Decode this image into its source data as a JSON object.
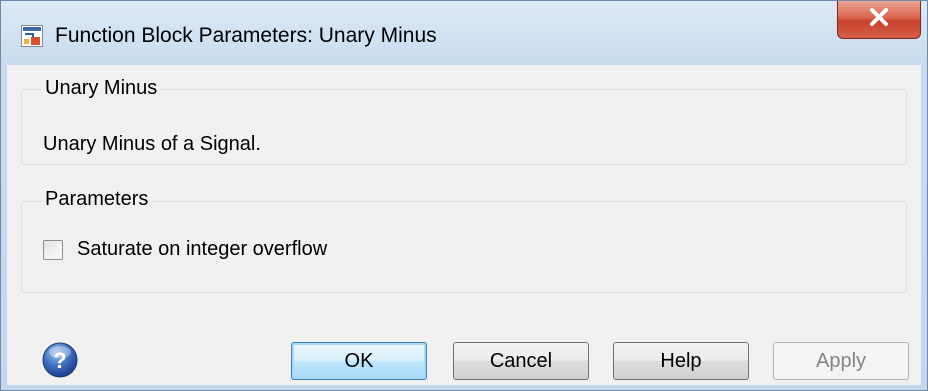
{
  "window": {
    "title": "Function Block Parameters: Unary Minus",
    "app_icon": "simulink-block-icon",
    "close_icon": "close-icon"
  },
  "description_group": {
    "label": "Unary Minus",
    "text": "Unary Minus of a Signal."
  },
  "parameters_group": {
    "label": "Parameters",
    "saturate_label": "Saturate on integer overflow",
    "saturate_checked": false
  },
  "buttons": {
    "help_icon": "question-icon",
    "ok": "OK",
    "cancel": "Cancel",
    "help": "Help",
    "apply": "Apply"
  },
  "colors": {
    "close_button": "#c7412c",
    "default_button_border": "#3c7fb1"
  }
}
